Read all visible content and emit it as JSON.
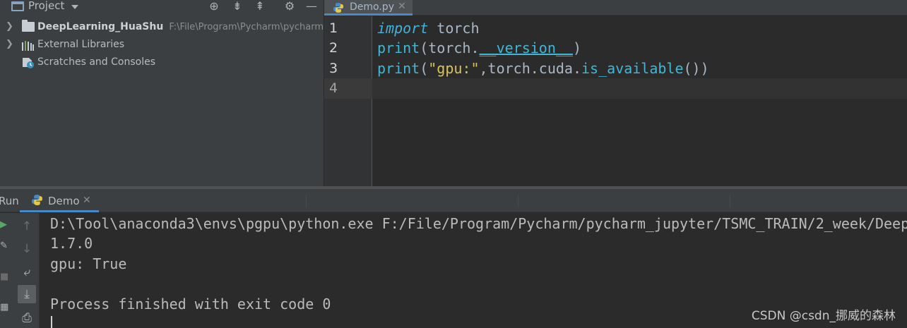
{
  "project_panel": {
    "title": "Project",
    "toolbar_icons": [
      "locate-icon",
      "expand-all-icon",
      "collapse-all-icon",
      "gear-icon",
      "minimize-icon"
    ],
    "tree": [
      {
        "label": "DeepLearning_HuaShu",
        "path": "F:\\File\\Program\\Pycharm\\pycharm_ju",
        "icon": "folder-icon"
      },
      {
        "label": "External Libraries",
        "icon": "libraries-icon"
      },
      {
        "label": "Scratches and Consoles",
        "icon": "scratches-icon"
      }
    ]
  },
  "editor": {
    "tab_label": "Demo.py",
    "line_numbers": [
      "1",
      "2",
      "3",
      "4"
    ],
    "lines": [
      {
        "kw": "import",
        "rest": " torch"
      },
      {
        "fn": "print",
        "p1": "(torch.",
        "dunder": "__version__",
        "p2": ")"
      },
      {
        "fn": "print",
        "p1": "(",
        "str": "\"gpu:\"",
        "p2": ",torch.cuda.",
        "fn2": "is_available",
        "p3": "())"
      }
    ]
  },
  "run_panel": {
    "label": "Run:",
    "tab_label": "Demo",
    "console_lines": [
      "D:\\Tool\\anaconda3\\envs\\pgpu\\python.exe F:/File/Program/Pycharm/pycharm_jupyter/TSMC_TRAIN/2_week/Deep",
      "1.7.0",
      "gpu: True",
      "",
      "Process finished with exit code 0"
    ]
  },
  "watermark": "CSDN @csdn_挪威的森林",
  "colors": {
    "accent": "#4a88c7",
    "keyword": "#44b2d6",
    "string": "#d8c55a",
    "background": "#2b2b2b",
    "panel": "#3c3f41"
  }
}
